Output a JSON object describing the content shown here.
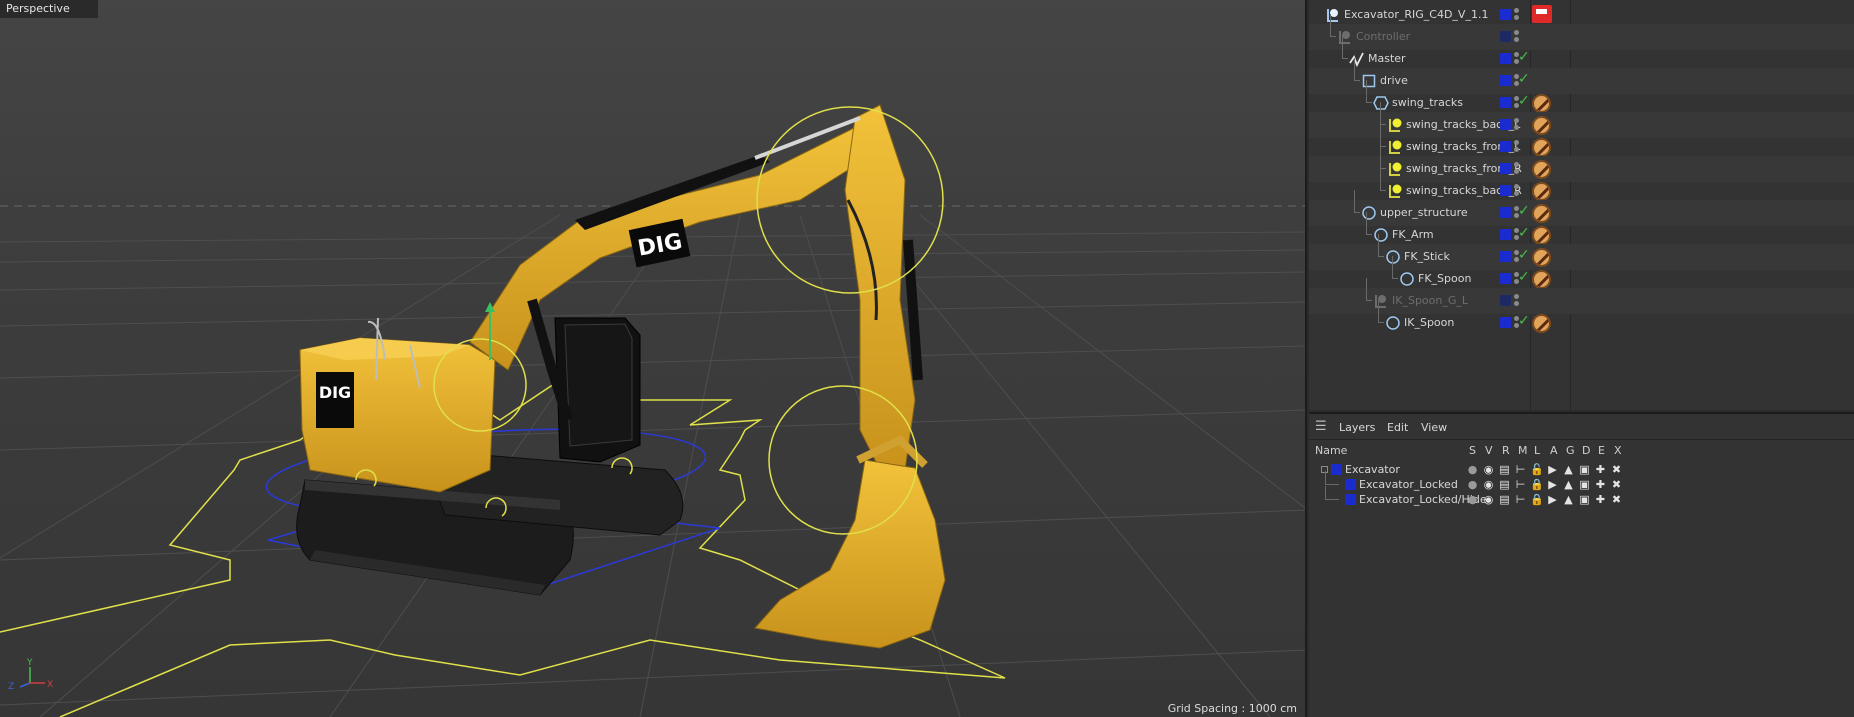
{
  "viewport": {
    "label": "Perspective",
    "grid_spacing": "Grid Spacing : 1000 cm",
    "logo_text": "DIG",
    "colors": {
      "body": "#e8b22a",
      "ctrl": "#e0e04a",
      "nav": "#2a3ad8"
    }
  },
  "object_manager": {
    "objects": [
      {
        "name": "Excavator_RIG_C4D_V_1.1",
        "icon": "null-object-icon",
        "dim": false,
        "check": false,
        "tag": "red-tag"
      },
      {
        "name": "Controller",
        "icon": "null-object-icon",
        "dim": true,
        "check": false,
        "tag": ""
      },
      {
        "name": "Master",
        "icon": "spline-icon",
        "dim": false,
        "check": true,
        "tag": ""
      },
      {
        "name": "drive",
        "icon": "square-spline-icon",
        "dim": false,
        "check": true,
        "tag": ""
      },
      {
        "name": "swing_tracks",
        "icon": "hexagon-spline-icon",
        "dim": false,
        "check": true,
        "tag": "protection-tag"
      },
      {
        "name": "swing_tracks_back_L",
        "icon": "bone-icon",
        "dim": false,
        "check": false,
        "tag": "protection-tag"
      },
      {
        "name": "swing_tracks_front_L",
        "icon": "bone-icon",
        "dim": false,
        "check": false,
        "tag": "protection-tag"
      },
      {
        "name": "swing_tracks_front_R",
        "icon": "bone-icon",
        "dim": false,
        "check": false,
        "tag": "protection-tag"
      },
      {
        "name": "swing_tracks_back_R",
        "icon": "bone-icon",
        "dim": false,
        "check": false,
        "tag": "protection-tag"
      },
      {
        "name": "upper_structure",
        "icon": "circle-spline-icon",
        "dim": false,
        "check": true,
        "tag": "protection-tag"
      },
      {
        "name": "FK_Arm",
        "icon": "circle-spline-icon",
        "dim": false,
        "check": true,
        "tag": "protection-tag"
      },
      {
        "name": "FK_Stick",
        "icon": "circle-spline-icon",
        "dim": false,
        "check": true,
        "tag": "protection-tag"
      },
      {
        "name": "FK_Spoon",
        "icon": "circle-spline-icon",
        "dim": false,
        "check": true,
        "tag": "protection-tag"
      },
      {
        "name": "IK_Spoon_G_L",
        "icon": "null-object-icon",
        "dim": true,
        "check": false,
        "tag": ""
      },
      {
        "name": "IK_Spoon",
        "icon": "circle-spline-icon",
        "dim": false,
        "check": true,
        "tag": "protection-tag"
      }
    ]
  },
  "layers": {
    "menu": [
      "Layers",
      "Edit",
      "View"
    ],
    "columns": {
      "name": "Name",
      "flags": [
        "S",
        "V",
        "R",
        "M",
        "L",
        "A",
        "G",
        "D",
        "E",
        "X"
      ]
    },
    "rows": [
      {
        "name": "Excavator",
        "color": "#1a2bd0",
        "locked": false
      },
      {
        "name": "Excavator_Locked",
        "color": "#1a2bd0",
        "locked": true
      },
      {
        "name": "Excavator_Locked/Hide",
        "color": "#1a2bd0",
        "locked": true
      }
    ]
  }
}
